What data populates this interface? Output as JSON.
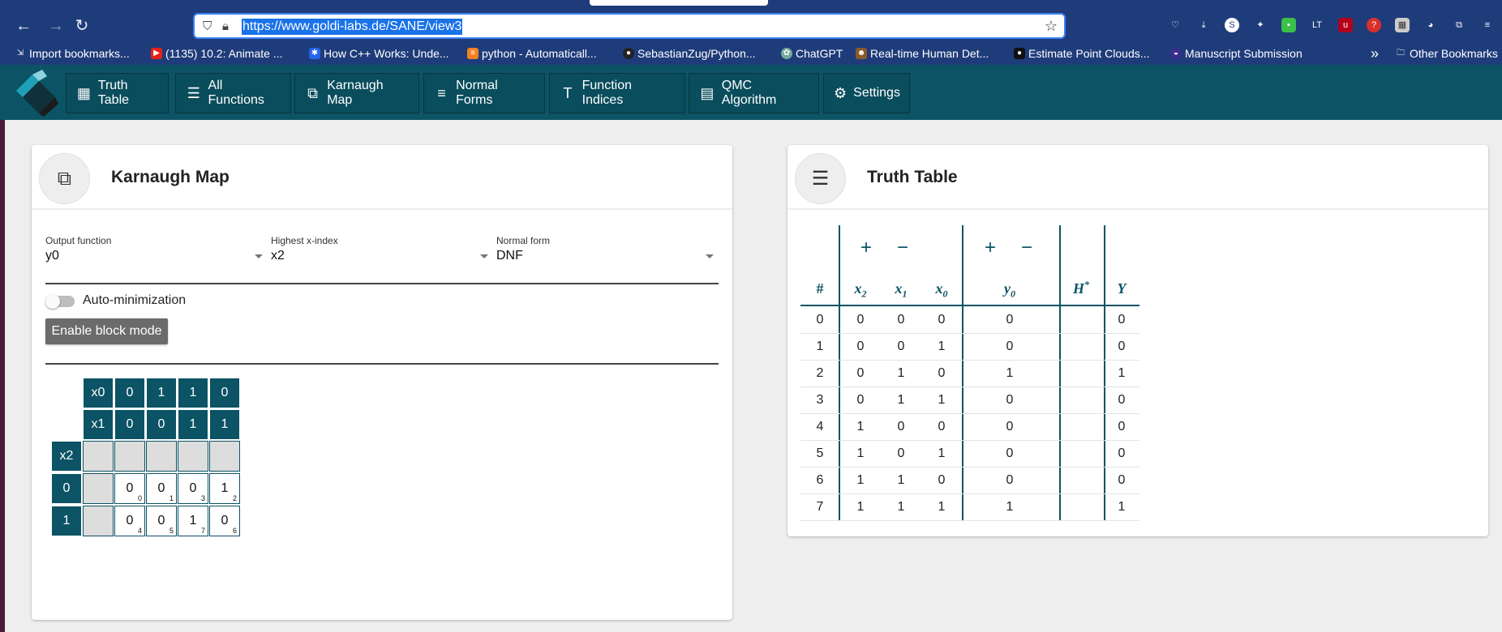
{
  "browser": {
    "url": "https://www.goldi-labs.de/SANE/view3",
    "bookmarks": [
      "Import bookmarks...",
      "(1135) 10.2: Animate ...",
      "How C++ Works: Unde...",
      "python - Automaticall...",
      "SebastianZug/Python...",
      "ChatGPT",
      "Real-time Human Det...",
      "Estimate Point Clouds...",
      "Manuscript Submission"
    ],
    "overflow": "»",
    "other_bookmarks": "Other Bookmarks"
  },
  "nav": [
    {
      "label": "Truth Table",
      "icon": "grid-table-icon"
    },
    {
      "label": "All Functions",
      "icon": "list-icon"
    },
    {
      "label": "Karnaugh Map",
      "icon": "copy-squares-icon"
    },
    {
      "label": "Normal Forms",
      "icon": "text-lines-icon"
    },
    {
      "label": "Function Indices",
      "icon": "text-size-icon"
    },
    {
      "label": "QMC Algorithm",
      "icon": "table-rows-icon"
    },
    {
      "label": "Settings",
      "icon": "gear-icon"
    }
  ],
  "kmap_card": {
    "title": "Karnaugh Map",
    "output_function": {
      "label": "Output function",
      "value": "y0"
    },
    "highest_x_index": {
      "label": "Highest x-index",
      "value": "x2"
    },
    "normal_form": {
      "label": "Normal form",
      "value": "DNF"
    },
    "auto_minimization": {
      "label": "Auto-minimization",
      "on": false
    },
    "block_mode_button": "Enable block mode",
    "kmap": {
      "x0_label": "x0",
      "x0_values": [
        "0",
        "1",
        "1",
        "0"
      ],
      "x1_label": "x1",
      "x1_values": [
        "0",
        "0",
        "1",
        "1"
      ],
      "x2_label": "x2",
      "rows": [
        {
          "x2": "0",
          "cells": [
            {
              "v": "0",
              "i": "0"
            },
            {
              "v": "0",
              "i": "1"
            },
            {
              "v": "0",
              "i": "3"
            },
            {
              "v": "1",
              "i": "2"
            }
          ]
        },
        {
          "x2": "1",
          "cells": [
            {
              "v": "0",
              "i": "4"
            },
            {
              "v": "0",
              "i": "5"
            },
            {
              "v": "1",
              "i": "7"
            },
            {
              "v": "0",
              "i": "6"
            }
          ]
        }
      ]
    }
  },
  "truth_card": {
    "title": "Truth Table",
    "plus": "+",
    "minus": "−",
    "headers": {
      "idx": "#",
      "x2": "x",
      "x2_sub": "2",
      "x1": "x",
      "x1_sub": "1",
      "x0": "x",
      "x0_sub": "0",
      "y0": "y",
      "y0_sub": "0",
      "h": "H",
      "h_sup": "*",
      "y": "Y"
    },
    "rows": [
      {
        "n": "0",
        "x2": "0",
        "x1": "0",
        "x0": "0",
        "y0": "0",
        "h": "",
        "Y": "0"
      },
      {
        "n": "1",
        "x2": "0",
        "x1": "0",
        "x0": "1",
        "y0": "0",
        "h": "",
        "Y": "0"
      },
      {
        "n": "2",
        "x2": "0",
        "x1": "1",
        "x0": "0",
        "y0": "1",
        "h": "",
        "Y": "1"
      },
      {
        "n": "3",
        "x2": "0",
        "x1": "1",
        "x0": "1",
        "y0": "0",
        "h": "",
        "Y": "0"
      },
      {
        "n": "4",
        "x2": "1",
        "x1": "0",
        "x0": "0",
        "y0": "0",
        "h": "",
        "Y": "0"
      },
      {
        "n": "5",
        "x2": "1",
        "x1": "0",
        "x0": "1",
        "y0": "0",
        "h": "",
        "Y": "0"
      },
      {
        "n": "6",
        "x2": "1",
        "x1": "1",
        "x0": "0",
        "y0": "0",
        "h": "",
        "Y": "0"
      },
      {
        "n": "7",
        "x2": "1",
        "x1": "1",
        "x0": "1",
        "y0": "1",
        "h": "",
        "Y": "1"
      }
    ]
  },
  "colors": {
    "primary": "#0b5365",
    "browser_chrome": "#1f3c7a",
    "page_bg": "#eeeeee"
  }
}
